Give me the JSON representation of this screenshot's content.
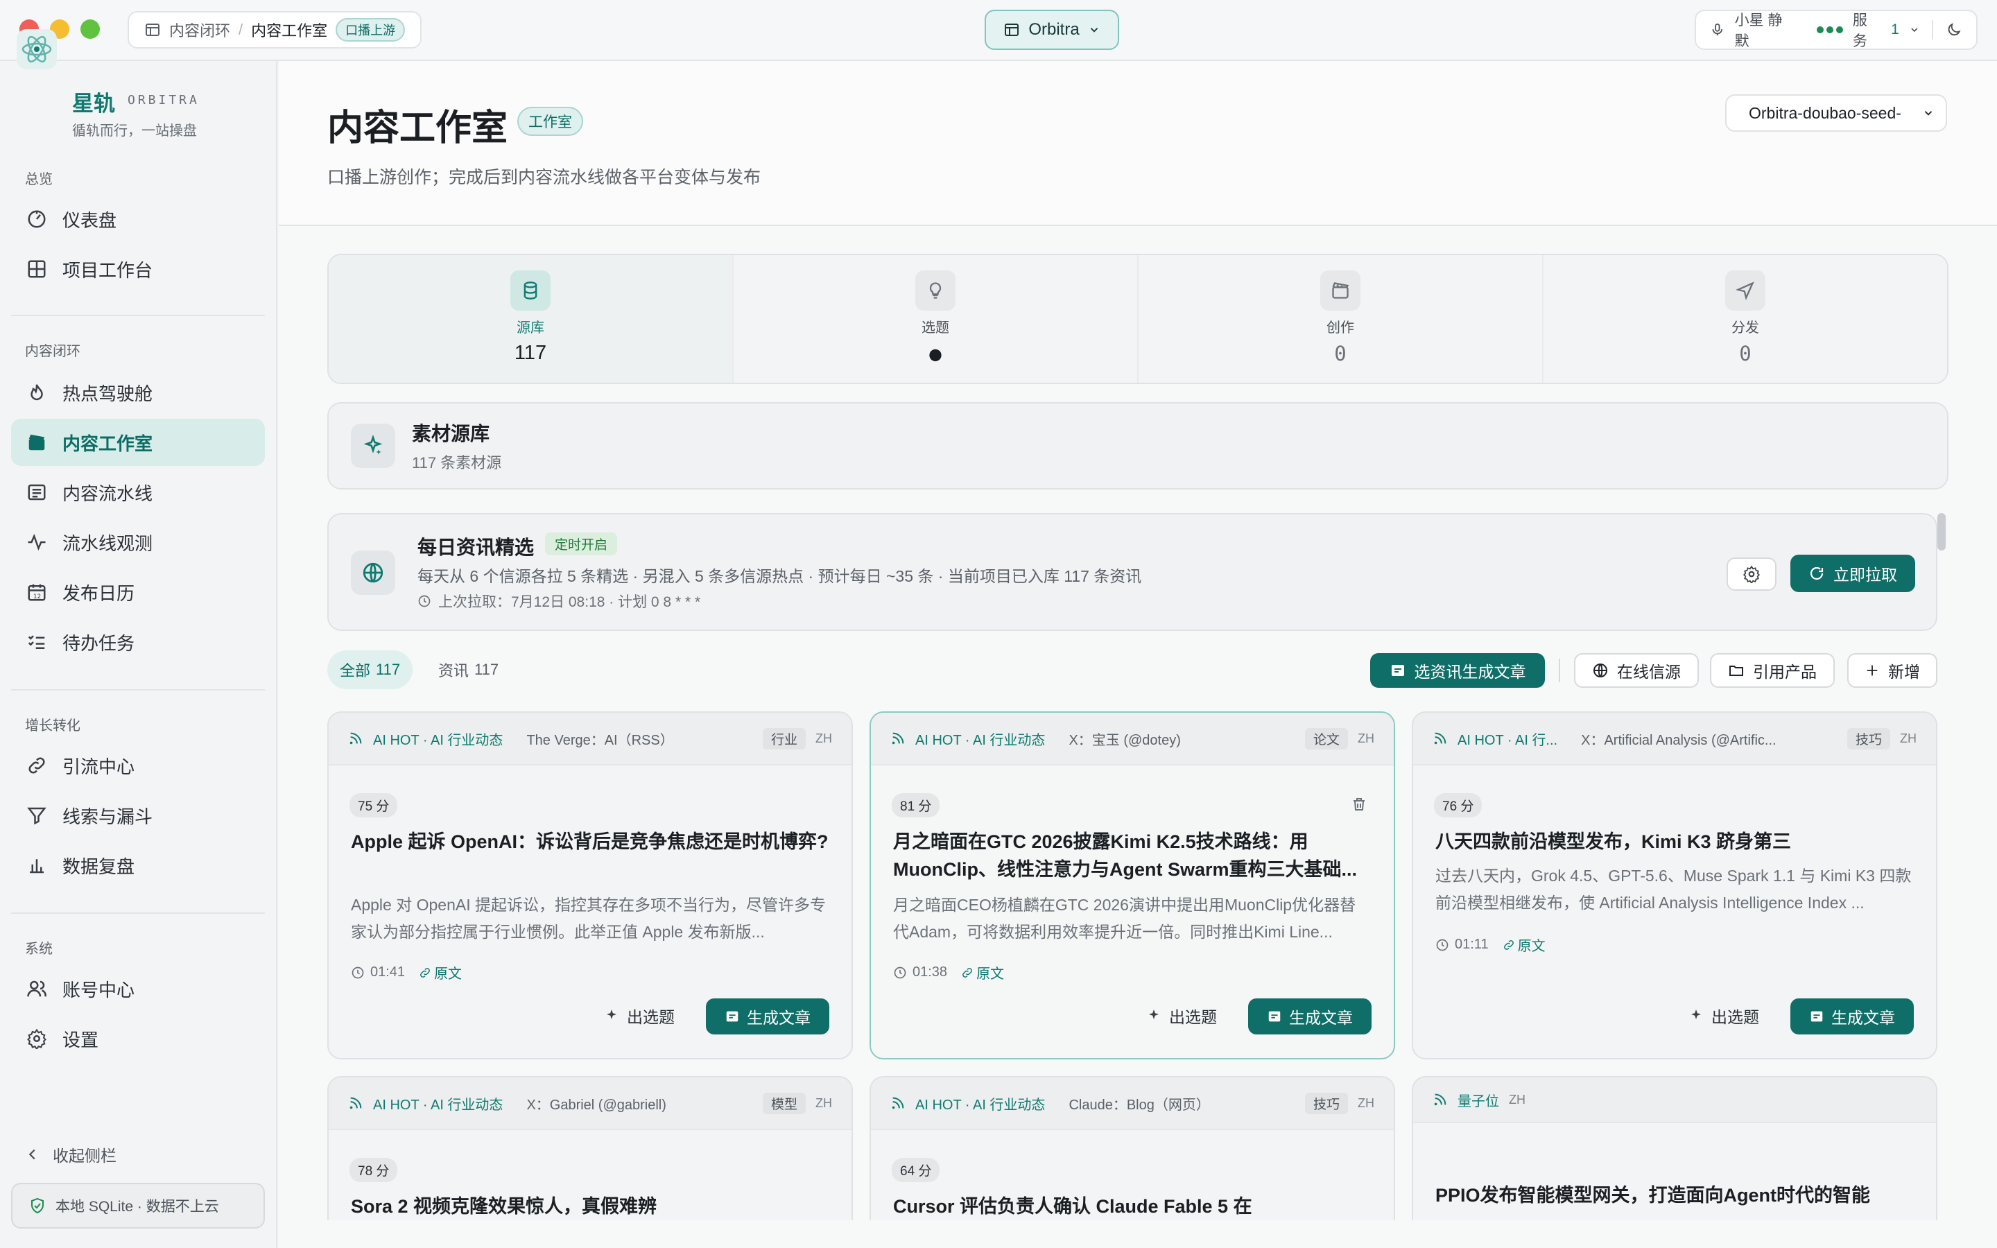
{
  "titlebar": {
    "crumb_parent": "内容闭环",
    "crumb_current": "内容工作室",
    "crumb_badge": "口播上游",
    "workspace": "Orbitra",
    "voice_label": "小星 静默",
    "service_label": "服务",
    "service_count": "1"
  },
  "brand": {
    "name": "星轨",
    "en": "ORBITRA",
    "slogan": "循轨而行，一站操盘"
  },
  "sidebar": {
    "sections": [
      {
        "title": "总览",
        "items": [
          {
            "label": "仪表盘",
            "icon": "gauge-icon"
          },
          {
            "label": "项目工作台",
            "icon": "grid-icon"
          }
        ]
      },
      {
        "title": "内容闭环",
        "items": [
          {
            "label": "热点驾驶舱",
            "icon": "flame-icon"
          },
          {
            "label": "内容工作室",
            "icon": "clapper-icon",
            "active": true
          },
          {
            "label": "内容流水线",
            "icon": "list-icon"
          },
          {
            "label": "流水线观测",
            "icon": "pulse-icon"
          },
          {
            "label": "发布日历",
            "icon": "calendar-icon"
          },
          {
            "label": "待办任务",
            "icon": "checklist-icon"
          }
        ]
      },
      {
        "title": "增长转化",
        "items": [
          {
            "label": "引流中心",
            "icon": "link-icon"
          },
          {
            "label": "线索与漏斗",
            "icon": "funnel-icon"
          },
          {
            "label": "数据复盘",
            "icon": "bar-chart-icon"
          }
        ]
      },
      {
        "title": "系统",
        "items": [
          {
            "label": "账号中心",
            "icon": "users-icon"
          },
          {
            "label": "设置",
            "icon": "gear-icon"
          }
        ]
      }
    ],
    "collapse": "收起侧栏",
    "storage": "本地 SQLite · 数据不上云"
  },
  "header": {
    "title": "内容工作室",
    "badge": "工作室",
    "subtitle": "口播上游创作；完成后到内容流水线做各平台变体与发布",
    "model": "Orbitra-doubao-seed-"
  },
  "steps": [
    {
      "label": "源库",
      "value": "117",
      "icon": "database-icon",
      "active": true
    },
    {
      "label": "选题",
      "value": "●",
      "icon": "bulb-icon"
    },
    {
      "label": "创作",
      "value": "0",
      "icon": "clapper-icon"
    },
    {
      "label": "分发",
      "value": "0",
      "icon": "send-icon"
    }
  ],
  "library": {
    "title": "素材源库",
    "sub": "117 条素材源"
  },
  "daily": {
    "title": "每日资讯精选",
    "tag": "定时开启",
    "desc": "每天从 6 个信源各拉 5 条精选 · 另混入 5 条多信源热点 · 预计每日 ~35 条 · 当前项目已入库 117 条资讯",
    "last": "上次拉取：7月12日 08:18 · 计划 0 8 * * *",
    "pull": "立即拉取"
  },
  "filters": {
    "all_label": "全部",
    "all_count": "117",
    "news_label": "资讯",
    "news_count": "117"
  },
  "toolbar": {
    "gen_all": "选资讯生成文章",
    "online": "在线信源",
    "cite": "引用产品",
    "add": "新增"
  },
  "cards": [
    {
      "src": "AI HOT · AI 行业动态",
      "who": "The Verge：AI（RSS）",
      "cat": "行业",
      "lang": "ZH",
      "score": "75 分",
      "title": "Apple 起诉 OpenAI：诉讼背后是竞争焦虑还是时机博弈?",
      "desc": "Apple 对 OpenAI 提起诉讼，指控其存在多项不当行为，尽管许多专家认为部分指控属于行业惯例。此举正值 Apple 发布新版...",
      "time": "01:41",
      "link": "原文",
      "topic": "出选题",
      "gen": "生成文章"
    },
    {
      "src": "AI HOT · AI 行业动态",
      "who": "X：宝玉 (@dotey)",
      "cat": "论文",
      "lang": "ZH",
      "score": "81 分",
      "title": "月之暗面在GTC 2026披露Kimi K2.5技术路线：用MuonClip、线性注意力与Agent Swarm重构三大基础...",
      "desc": "月之暗面CEO杨植麟在GTC 2026演讲中提出用MuonClip优化器替代Adam，可将数据利用效率提升近一倍。同时推出Kimi Line...",
      "time": "01:38",
      "link": "原文",
      "topic": "出选题",
      "gen": "生成文章"
    },
    {
      "src": "AI HOT · AI 行...",
      "who": "X：Artificial Analysis (@Artific...",
      "cat": "技巧",
      "lang": "ZH",
      "score": "76 分",
      "title": "八天四款前沿模型发布，Kimi K3 跻身第三",
      "desc": "过去八天内，Grok 4.5、GPT-5.6、Muse Spark 1.1 与 Kimi K3 四款前沿模型相继发布，使 Artificial Analysis Intelligence Index ...",
      "time": "01:11",
      "link": "原文",
      "topic": "出选题",
      "gen": "生成文章"
    },
    {
      "src": "AI HOT · AI 行业动态",
      "who": "X：Gabriel (@gabriell)",
      "cat": "模型",
      "lang": "ZH",
      "score": "78 分",
      "title": "Sora 2 视频克隆效果惊人，真假难辨"
    },
    {
      "src": "AI HOT · AI 行业动态",
      "who": "Claude：Blog（网页）",
      "cat": "技巧",
      "lang": "ZH",
      "score": "64 分",
      "title": "Cursor 评估负责人确认 Claude Fable 5 在"
    },
    {
      "src": "量子位",
      "lang": "ZH",
      "title": "PPIO发布智能模型网关，打造面向Agent时代的智能"
    }
  ],
  "colors": {
    "accent": "#0f6e67",
    "accent_light": "#dff0ee",
    "red": "#ee5f57",
    "yellow": "#f5bd30",
    "green": "#5fc33f"
  }
}
